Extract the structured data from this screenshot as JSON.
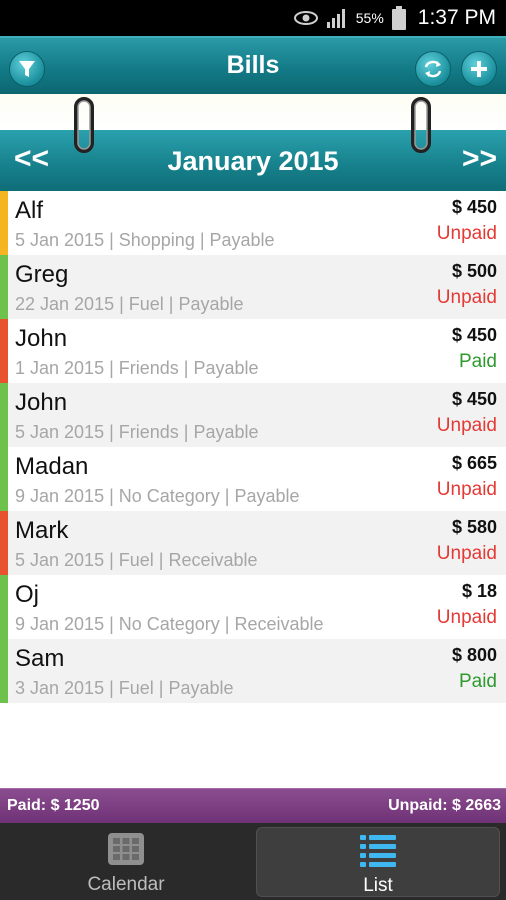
{
  "status_bar": {
    "battery_percent": "55%",
    "time": "1:37 PM",
    "icons": [
      "eye-icon",
      "signal-icon",
      "battery-icon"
    ]
  },
  "header": {
    "title": "Bills",
    "buttons": [
      "filter-icon",
      "sync-icon",
      "add-icon"
    ]
  },
  "month_nav": {
    "prev": "<<",
    "title": "January 2015",
    "next": ">>"
  },
  "bills": [
    {
      "name": "Alf",
      "meta": "5 Jan 2015 | Shopping | Payable",
      "amount": "$ 450",
      "status": "Unpaid",
      "color": "#f5b521"
    },
    {
      "name": "Greg",
      "meta": "22 Jan 2015 | Fuel | Payable",
      "amount": "$ 500",
      "status": "Unpaid",
      "color": "#6cc24a"
    },
    {
      "name": "John",
      "meta": "1 Jan 2015 | Friends | Payable",
      "amount": "$ 450",
      "status": "Paid",
      "color": "#e8522e"
    },
    {
      "name": "John",
      "meta": "5 Jan 2015 | Friends | Payable",
      "amount": "$ 450",
      "status": "Unpaid",
      "color": "#6cc24a"
    },
    {
      "name": "Madan",
      "meta": "9 Jan 2015 | No Category | Payable",
      "amount": "$ 665",
      "status": "Unpaid",
      "color": "#6cc24a"
    },
    {
      "name": "Mark",
      "meta": "5 Jan 2015 | Fuel | Receivable",
      "amount": "$ 580",
      "status": "Unpaid",
      "color": "#e8522e"
    },
    {
      "name": "Oj",
      "meta": "9 Jan 2015 | No Category | Receivable",
      "amount": "$ 18",
      "status": "Unpaid",
      "color": "#6cc24a"
    },
    {
      "name": "Sam",
      "meta": "3 Jan 2015 | Fuel | Payable",
      "amount": "$ 800",
      "status": "Paid",
      "color": "#6cc24a"
    }
  ],
  "summary": {
    "paid": "Paid: $ 1250",
    "unpaid": "Unpaid: $ 2663"
  },
  "tabs": {
    "calendar": "Calendar",
    "list": "List"
  },
  "colors": {
    "header_teal": "#137b87",
    "summary_purple": "#7a3d80",
    "unpaid_red": "#e53935",
    "paid_green": "#2e9a2e"
  }
}
